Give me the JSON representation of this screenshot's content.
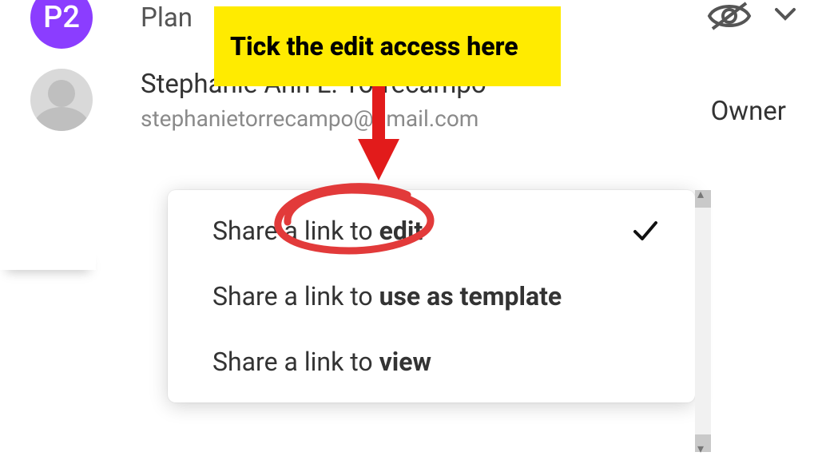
{
  "callout_text": "Tick the edit access here",
  "top_row": {
    "avatar_initials": "P2",
    "label_partial": "Plan"
  },
  "user": {
    "name": "Stephanie Ann L. Torrecampo",
    "email": "stephanietorrecampo@gmail.com",
    "role": "Owner"
  },
  "dropdown": {
    "items": [
      {
        "lead": "Share a link to ",
        "bold": "edit",
        "selected": true
      },
      {
        "lead": "Share a link to ",
        "bold": "use as template",
        "selected": false
      },
      {
        "lead": "Share a link to ",
        "bold": "view",
        "selected": false
      }
    ]
  }
}
